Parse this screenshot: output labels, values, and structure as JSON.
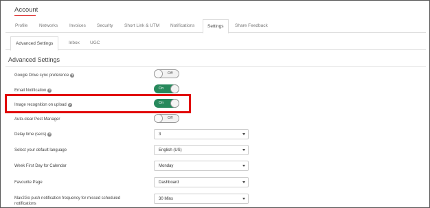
{
  "page": {
    "title": "Account"
  },
  "tabs": [
    {
      "label": "Profile"
    },
    {
      "label": "Networks"
    },
    {
      "label": "Invoices"
    },
    {
      "label": "Security"
    },
    {
      "label": "Short Link & UTM"
    },
    {
      "label": "Notifications"
    },
    {
      "label": "Settings",
      "active": true
    },
    {
      "label": "Share Feedback"
    }
  ],
  "subtabs": [
    {
      "label": "Advanced Settings",
      "active": true
    },
    {
      "label": "Inbox"
    },
    {
      "label": "UGC"
    }
  ],
  "section": {
    "title": "Advanced Settings"
  },
  "settings": {
    "google_drive": {
      "label": "Google Drive sync preference",
      "state": "Off"
    },
    "email_notification": {
      "label": "Email Notification",
      "state": "On"
    },
    "image_recognition": {
      "label": "Image recognition on upload",
      "state": "On"
    },
    "auto_clear": {
      "label": "Auto-clear Post Manager",
      "state": "Off"
    },
    "delay_time": {
      "label": "Delay time (secs)",
      "value": "3"
    },
    "default_language": {
      "label": "Select your default language",
      "value": "English (US)"
    },
    "week_first_day": {
      "label": "Week First Day for Calendar",
      "value": "Monday"
    },
    "favourite_page": {
      "label": "Favourite Page",
      "value": "Dashboard"
    },
    "push_frequency": {
      "label": "Mav2Go push notification frequency for missed scheduled",
      "label_line2": "notifications",
      "value": "30 Mins"
    }
  },
  "help_glyph": "?",
  "colors": {
    "toggle_on": "#27895c",
    "highlight": "#e10000",
    "title_underline": "#e03a3a"
  }
}
